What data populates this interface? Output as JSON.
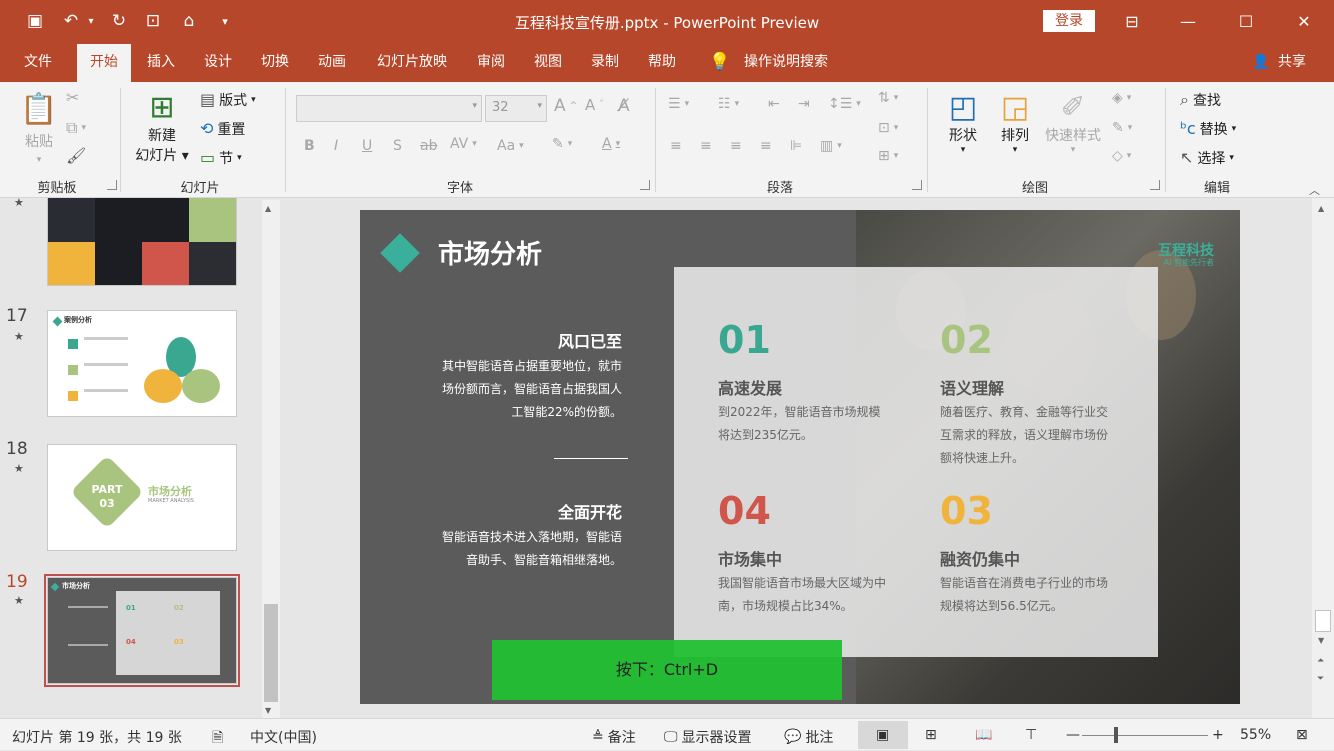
{
  "window": {
    "title": "互程科技宣传册.pptx  -  PowerPoint Preview",
    "login_label": "登录",
    "minimize_icon": "minimize-icon",
    "maximize_icon": "maximize-icon",
    "close_icon": "close-icon"
  },
  "tabs": [
    "文件",
    "开始",
    "插入",
    "设计",
    "切换",
    "动画",
    "幻灯片放映",
    "审阅",
    "视图",
    "录制",
    "帮助"
  ],
  "active_tab": "开始",
  "tell_me": "操作说明搜索",
  "share_label": "共享",
  "ribbon": {
    "clipboard": {
      "label": "剪贴板",
      "paste": "粘贴"
    },
    "slides": {
      "label": "幻灯片",
      "new_slide_line1": "新建",
      "new_slide_line2": "幻灯片",
      "layout": "版式",
      "reset": "重置",
      "section": "节"
    },
    "font": {
      "label": "字体",
      "font_size": "32",
      "font_name": ""
    },
    "paragraph": {
      "label": "段落"
    },
    "drawing": {
      "label": "绘图",
      "shapes": "形状",
      "arrange": "排列",
      "quick_styles": "快速样式"
    },
    "editing": {
      "label": "编辑",
      "find": "查找",
      "replace": "替换",
      "select": "选择"
    }
  },
  "slide_list": [
    {
      "number": "17",
      "title": "案例分析"
    },
    {
      "number": "18",
      "part": "PART",
      "part_no": "03",
      "heading": "市场分析",
      "sub": "MARKET ANALYSIS"
    },
    {
      "number": "19",
      "title": "市场分析"
    }
  ],
  "slide": {
    "title": "市场分析",
    "logo_name": "互程科技",
    "logo_tagline": "AI 智能先行者",
    "left_blocks": [
      {
        "heading": "风口已至",
        "body": "其中智能语音占据重要地位，就市场份额而言，智能语音占据我国人工智能22%的份额。"
      },
      {
        "heading": "全面开花",
        "body": "智能语音技术进入落地期，智能语音助手、智能音箱相继落地。"
      }
    ],
    "items": [
      {
        "num": "01",
        "title": "高速发展",
        "body": "到2022年，智能语音市场规模将达到235亿元。",
        "color": "#3aa890"
      },
      {
        "num": "02",
        "title": "语义理解",
        "body": "随着医疗、教育、金融等行业交互需求的释放，语义理解市场份额将快速上升。",
        "color": "#a9c47e"
      },
      {
        "num": "04",
        "title": "市场集中",
        "body": "我国智能语音市场最大区域为中南，市场规模占比34%。",
        "color": "#d0554a"
      },
      {
        "num": "03",
        "title": "融资仍集中",
        "body": "智能语音在消费电子行业的市场规模将达到56.5亿元。",
        "color": "#f0b43c"
      }
    ],
    "accent_color": "#3ab09a"
  },
  "overlay_hint": "按下：Ctrl+D",
  "status": {
    "slide_info": "幻灯片 第 19 张，共 19 张",
    "language": "中文(中国)",
    "notes": "备注",
    "display_settings": "显示器设置",
    "comments": "批注",
    "zoom": "55%",
    "zoom_level_fraction": 0.55
  },
  "colors": {
    "brand": "#b7472a",
    "ribbon": "#f3f3f3",
    "hint": "#22c032"
  }
}
